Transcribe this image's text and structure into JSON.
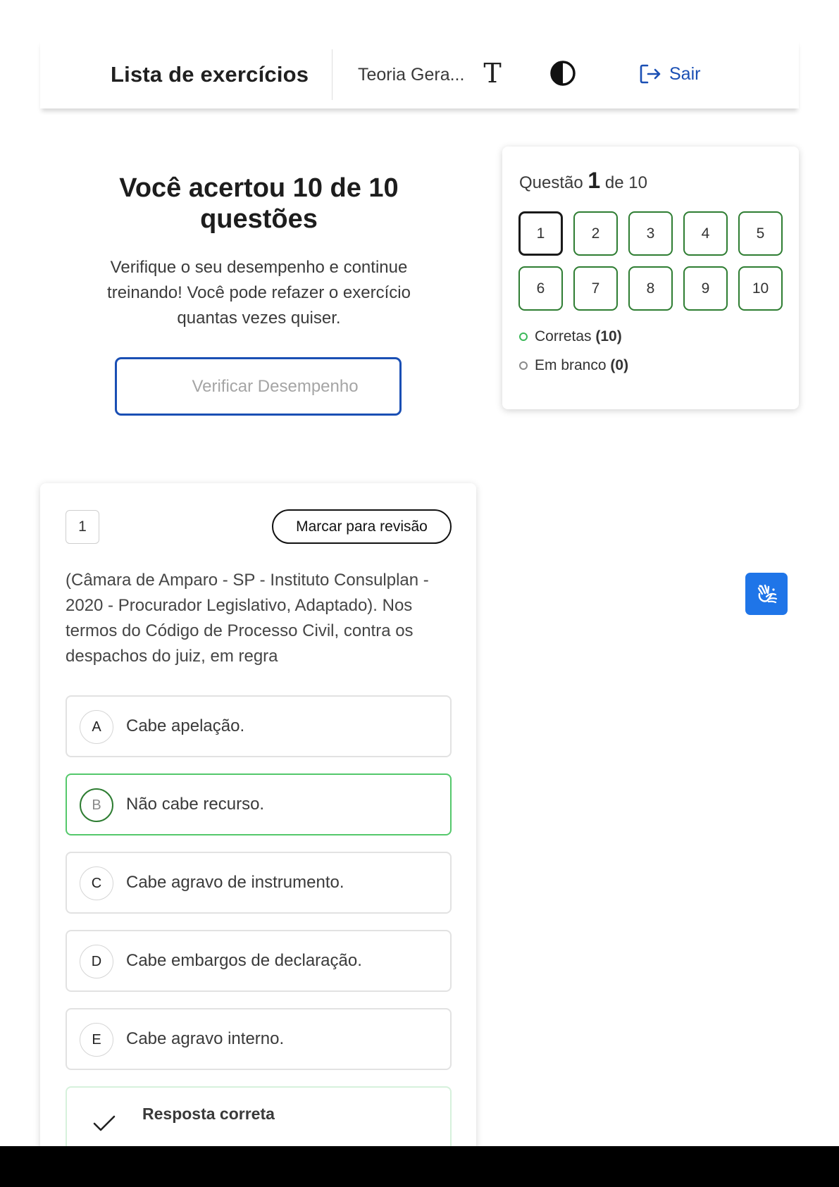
{
  "header": {
    "title": "Lista de exercícios",
    "subject": "Teoria Gera...",
    "font_size_glyph": "T",
    "logout_label": "Sair"
  },
  "result": {
    "title": "Você acertou 10 de 10 questões",
    "description": "Verifique o seu desempenho e continue treinando! Você pode refazer o exercício quantas vezes quiser.",
    "button_label": "Verificar Desempenho"
  },
  "navigator": {
    "prefix": "Questão",
    "current": "1",
    "suffix": "de 10",
    "questions": [
      "1",
      "2",
      "3",
      "4",
      "5",
      "6",
      "7",
      "8",
      "9",
      "10"
    ],
    "correct_label": "Corretas",
    "correct_count": "(10)",
    "blank_label": "Em branco",
    "blank_count": "(0)"
  },
  "question": {
    "number": "1",
    "review_label": "Marcar para revisão",
    "text": "(Câmara de Amparo - SP - Instituto Consulplan - 2020 - Procurador Legislativo, Adaptado). Nos termos do Código de Processo Civil, contra os despachos do juiz, em regra",
    "options": [
      {
        "letter": "A",
        "text": "Cabe apelação."
      },
      {
        "letter": "B",
        "text": "Não cabe recurso."
      },
      {
        "letter": "C",
        "text": "Cabe agravo de instrumento."
      },
      {
        "letter": "D",
        "text": "Cabe embargos de declaração."
      },
      {
        "letter": "E",
        "text": "Cabe agravo interno."
      }
    ],
    "correct_option": "B",
    "answer_title": "Resposta correta"
  },
  "colors": {
    "primary": "#1a4fb4",
    "correct": "#54c86b",
    "nav_border": "#2e7d32",
    "libras": "#1f75e8"
  },
  "icons": [
    "font-size-icon",
    "contrast-icon",
    "logout-icon",
    "check-icon",
    "sign-language-icon"
  ]
}
